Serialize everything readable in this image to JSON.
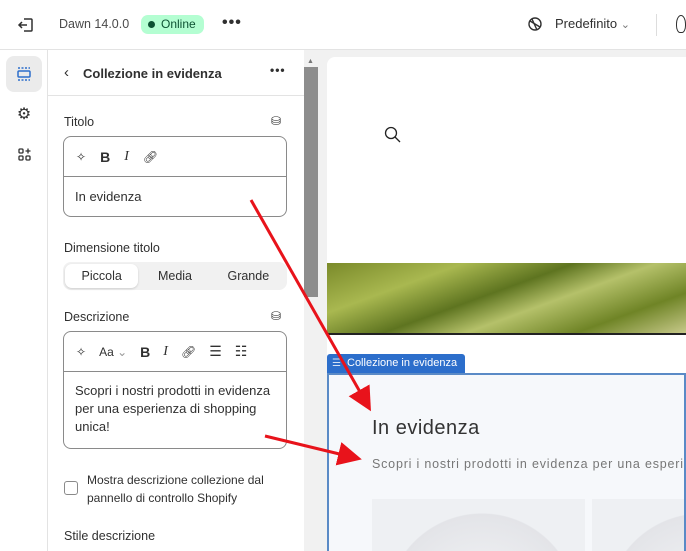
{
  "topbar": {
    "theme_name": "Dawn 14.0.0",
    "status": "Online",
    "status_color": "#b4fed2",
    "locale": "Predefinito"
  },
  "panel": {
    "title": "Collezione in evidenza",
    "title_field": {
      "label": "Titolo",
      "value": "In evidenza"
    },
    "size": {
      "label": "Dimensione titolo",
      "options": [
        "Piccola",
        "Media",
        "Grande"
      ],
      "selected": "Piccola"
    },
    "description": {
      "label": "Descrizione",
      "format_label": "Aa",
      "value": "Scopri i nostri prodotti in evidenza per una esperienza di shopping unica!"
    },
    "checkbox": {
      "label": "Mostra descrizione collezione dal pannello di controllo Shopify",
      "checked": false
    },
    "style_label": "Stile descrizione"
  },
  "preview": {
    "section_tag": "Collezione in evidenza",
    "heading": "In evidenza",
    "description": "Scopri i nostri prodotti in evidenza per una esperienza di shopping unica!",
    "accent": "#2c6ecb"
  }
}
